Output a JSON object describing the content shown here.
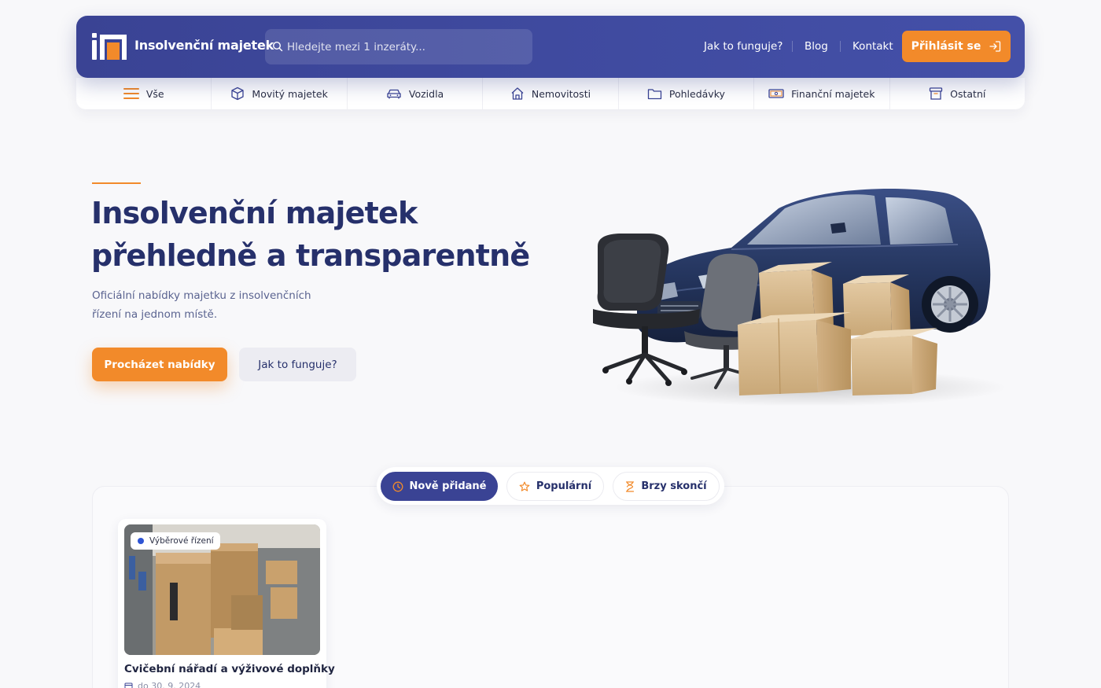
{
  "header": {
    "brand": "Insolvenční majetek",
    "search_placeholder": "Hledejte mezi 1 inzeráty...",
    "nav": [
      "Jak to funguje?",
      "Blog",
      "Kontakt"
    ],
    "login_label": "Přihlásit se"
  },
  "categories": [
    {
      "label": "Vše",
      "icon": "menu-icon"
    },
    {
      "label": "Movitý majetek",
      "icon": "box-icon"
    },
    {
      "label": "Vozidla",
      "icon": "car-icon"
    },
    {
      "label": "Nemovitosti",
      "icon": "house-icon"
    },
    {
      "label": "Pohledávky",
      "icon": "folder-icon"
    },
    {
      "label": "Finanční majetek",
      "icon": "banknote-icon"
    },
    {
      "label": "Ostatní",
      "icon": "archive-icon"
    }
  ],
  "hero": {
    "title_line1": "Insolvenční majetek",
    "title_line2": "přehledně a transparentně",
    "subtitle_line1": "Oficiální nabídky majetku z insolvenčních",
    "subtitle_line2": "řízení na jednom místě.",
    "primary_cta": "Procházet nabídky",
    "secondary_cta": "Jak to funguje?"
  },
  "listing_tabs": [
    {
      "label": "Nově přidané",
      "icon": "clock-icon",
      "active": true
    },
    {
      "label": "Populární",
      "icon": "star-icon",
      "active": false
    },
    {
      "label": "Brzy skončí",
      "icon": "hourglass-icon",
      "active": false
    }
  ],
  "listings": [
    {
      "badge": "Výběrové řízení",
      "title": "Cvičební nářadí a výživové doplňky",
      "meta": "do 30. 9. 2024"
    }
  ],
  "colors": {
    "primary": "#3a4394",
    "accent": "#f28a2a",
    "text_dark": "#26306b",
    "badge_dot": "#2f55d4"
  }
}
